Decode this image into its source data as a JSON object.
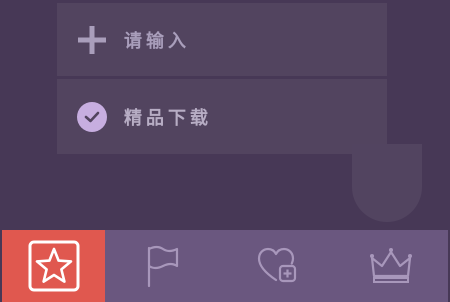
{
  "list": {
    "input_placeholder": "请输入",
    "item_label": "精品下载"
  },
  "tabbar": {
    "active_index": 0,
    "tabs": [
      {
        "icon": "star-icon",
        "active": true
      },
      {
        "icon": "flag-icon",
        "active": false
      },
      {
        "icon": "heart-plus-icon",
        "active": false
      },
      {
        "icon": "crown-icon",
        "active": false
      }
    ]
  },
  "colors": {
    "background": "#473856",
    "panel": "#52445f",
    "tabbar": "#6a577f",
    "active_tab": "#e0584f",
    "text": "#a99ebb",
    "check": "#c7aee0"
  }
}
